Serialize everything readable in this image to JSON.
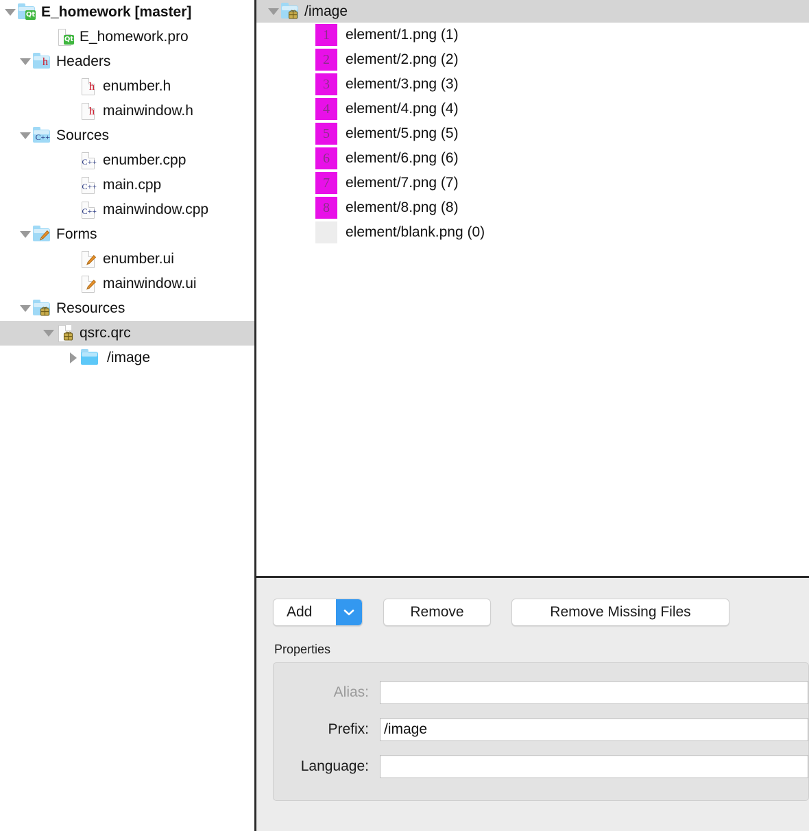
{
  "sidebar": {
    "items": [
      {
        "label": "E_homework [master]",
        "indent": 0,
        "arrow": "expanded",
        "icon": "qt-project-folder-icon",
        "bold": true,
        "selected": false
      },
      {
        "label": "E_homework.pro",
        "indent": 1,
        "arrow": "none",
        "icon": "qt-pro-file-icon",
        "bold": false,
        "selected": false
      },
      {
        "label": "Headers",
        "indent": 1,
        "arrow": "expanded",
        "icon": "headers-folder-icon",
        "bold": false,
        "selected": false
      },
      {
        "label": "enumber.h",
        "indent": 2,
        "arrow": "none",
        "icon": "h-file-icon",
        "bold": false,
        "selected": false
      },
      {
        "label": "mainwindow.h",
        "indent": 2,
        "arrow": "none",
        "icon": "h-file-icon",
        "bold": false,
        "selected": false
      },
      {
        "label": "Sources",
        "indent": 1,
        "arrow": "expanded",
        "icon": "sources-folder-icon",
        "bold": false,
        "selected": false
      },
      {
        "label": "enumber.cpp",
        "indent": 2,
        "arrow": "none",
        "icon": "cpp-file-icon",
        "bold": false,
        "selected": false
      },
      {
        "label": "main.cpp",
        "indent": 2,
        "arrow": "none",
        "icon": "cpp-file-icon",
        "bold": false,
        "selected": false
      },
      {
        "label": "mainwindow.cpp",
        "indent": 2,
        "arrow": "none",
        "icon": "cpp-file-icon",
        "bold": false,
        "selected": false
      },
      {
        "label": "Forms",
        "indent": 1,
        "arrow": "expanded",
        "icon": "forms-folder-icon",
        "bold": false,
        "selected": false
      },
      {
        "label": "enumber.ui",
        "indent": 2,
        "arrow": "none",
        "icon": "ui-file-icon",
        "bold": false,
        "selected": false
      },
      {
        "label": "mainwindow.ui",
        "indent": 2,
        "arrow": "none",
        "icon": "ui-file-icon",
        "bold": false,
        "selected": false
      },
      {
        "label": "Resources",
        "indent": 1,
        "arrow": "expanded",
        "icon": "resources-folder-icon",
        "bold": false,
        "selected": false
      },
      {
        "label": "qsrc.qrc",
        "indent": 2,
        "arrow": "expanded",
        "icon": "qrc-file-icon",
        "bold": false,
        "selected": true
      },
      {
        "label": "/image",
        "indent": 3,
        "arrow": "collapsed",
        "icon": "image-folder-icon",
        "bold": false,
        "selected": false
      }
    ]
  },
  "resource_editor": {
    "prefix_node": {
      "label": "/image",
      "arrow": "expanded",
      "icon": "qrc-prefix-folder-icon"
    },
    "files": [
      {
        "thumb": "1",
        "blank": false,
        "label": "element/1.png (1)"
      },
      {
        "thumb": "2",
        "blank": false,
        "label": "element/2.png (2)"
      },
      {
        "thumb": "3",
        "blank": false,
        "label": "element/3.png (3)"
      },
      {
        "thumb": "4",
        "blank": false,
        "label": "element/4.png (4)"
      },
      {
        "thumb": "5",
        "blank": false,
        "label": "element/5.png (5)"
      },
      {
        "thumb": "6",
        "blank": false,
        "label": "element/6.png (6)"
      },
      {
        "thumb": "7",
        "blank": false,
        "label": "element/7.png (7)"
      },
      {
        "thumb": "8",
        "blank": false,
        "label": "element/8.png (8)"
      },
      {
        "thumb": "",
        "blank": true,
        "label": "element/blank.png (0)"
      }
    ],
    "toolbar": {
      "add_label": "Add",
      "add_dropdown_icon": "chevron-down-icon",
      "remove_label": "Remove",
      "remove_missing_label": "Remove Missing Files"
    },
    "properties": {
      "title": "Properties",
      "alias_label": "Alias:",
      "alias_value": "",
      "alias_disabled": true,
      "prefix_label": "Prefix:",
      "prefix_value": "/image",
      "language_label": "Language:",
      "language_value": ""
    }
  },
  "colors": {
    "thumbnail_magenta": "#e810e8",
    "thumbnail_blank": "#ededed",
    "selection_gray": "#d5d5d5",
    "dropdown_blue": "#3398f0",
    "panel_gray": "#ececec"
  }
}
